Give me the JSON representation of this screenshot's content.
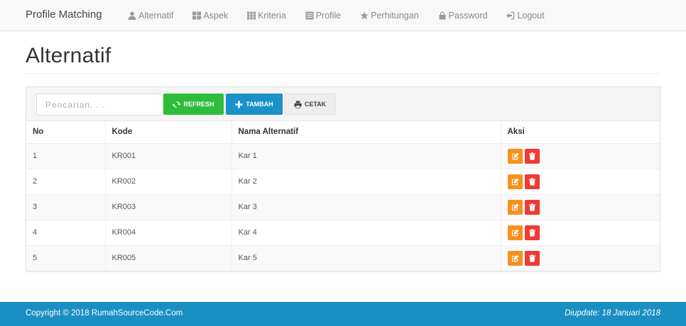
{
  "navbar": {
    "brand": "Profile Matching",
    "items": [
      {
        "label": "Alternatif",
        "icon": "user-icon"
      },
      {
        "label": "Aspek",
        "icon": "grid-icon"
      },
      {
        "label": "Kriteria",
        "icon": "grid-small-icon"
      },
      {
        "label": "Profile",
        "icon": "list-icon"
      },
      {
        "label": "Perhitungan",
        "icon": "star-icon"
      },
      {
        "label": "Password",
        "icon": "lock-icon"
      },
      {
        "label": "Logout",
        "icon": "logout-icon"
      }
    ]
  },
  "page": {
    "title": "Alternatif"
  },
  "toolbar": {
    "search_placeholder": "Pencarian. . .",
    "refresh_label": "REFRESH",
    "tambah_label": "TAMBAH",
    "cetak_label": "CETAK"
  },
  "table": {
    "headers": [
      "No",
      "Kode",
      "Nama Alternatif",
      "Aksi"
    ],
    "rows": [
      {
        "no": "1",
        "kode": "KR001",
        "nama": "Kar 1"
      },
      {
        "no": "2",
        "kode": "KR002",
        "nama": "Kar 2"
      },
      {
        "no": "3",
        "kode": "KR003",
        "nama": "Kar 3"
      },
      {
        "no": "4",
        "kode": "KR004",
        "nama": "Kar 4"
      },
      {
        "no": "5",
        "kode": "KR005",
        "nama": "Kar 5"
      }
    ]
  },
  "footer": {
    "copyright": "Copyright © 2018 RumahSourceCode.Com",
    "update": "Diupdate: 18 Januari 2018"
  },
  "colors": {
    "refresh": "#2ebd3b",
    "tambah": "#1a91c8",
    "edit": "#f7911d",
    "delete": "#ef3b33",
    "footer": "#1a8fc3"
  }
}
